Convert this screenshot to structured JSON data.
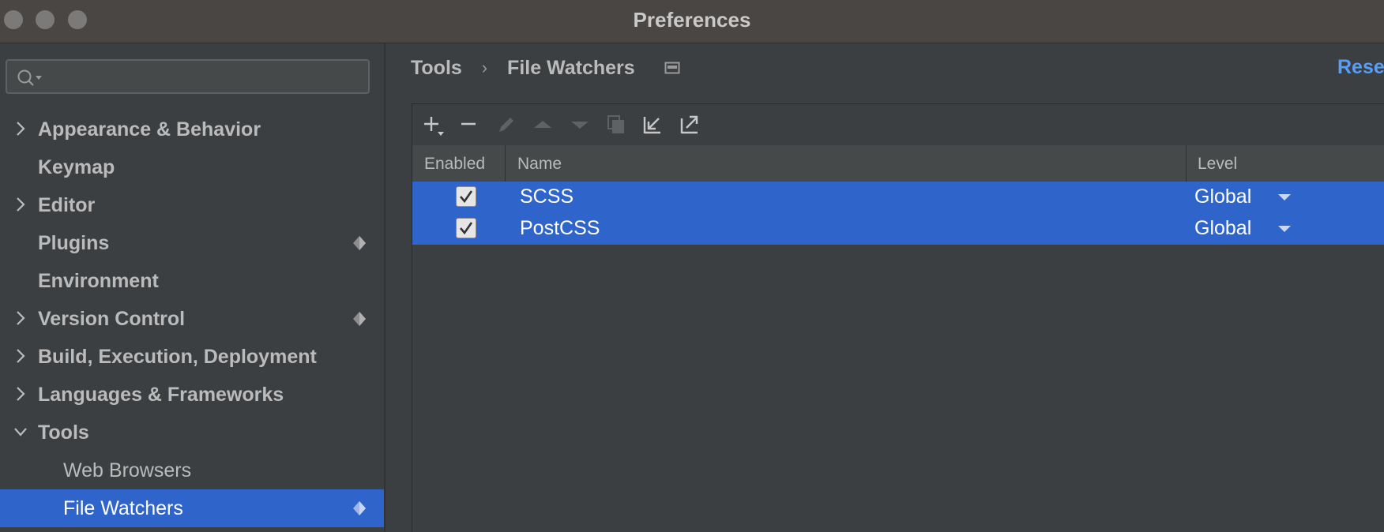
{
  "window": {
    "title": "Preferences"
  },
  "sidebar": {
    "search": {
      "placeholder": ""
    },
    "items": [
      {
        "label": "Appearance & Behavior",
        "expandable": true,
        "expanded": false,
        "badge": false
      },
      {
        "label": "Keymap",
        "expandable": false,
        "badge": false
      },
      {
        "label": "Editor",
        "expandable": true,
        "expanded": false,
        "badge": false
      },
      {
        "label": "Plugins",
        "expandable": false,
        "badge": true
      },
      {
        "label": "Environment",
        "expandable": false,
        "badge": false
      },
      {
        "label": "Version Control",
        "expandable": true,
        "expanded": false,
        "badge": true
      },
      {
        "label": "Build, Execution, Deployment",
        "expandable": true,
        "expanded": false,
        "badge": false
      },
      {
        "label": "Languages & Frameworks",
        "expandable": true,
        "expanded": false,
        "badge": false
      },
      {
        "label": "Tools",
        "expandable": true,
        "expanded": true,
        "badge": false
      },
      {
        "label": "Web Browsers",
        "sub": true,
        "badge": false
      },
      {
        "label": "File Watchers",
        "sub": true,
        "selected": true,
        "badge": true
      }
    ]
  },
  "main": {
    "breadcrumb": {
      "parent": "Tools",
      "separator": "›",
      "current": "File Watchers"
    },
    "reset_label": "Rese",
    "toolbar": [
      "add-icon",
      "remove-icon",
      "edit-icon",
      "move-up-icon",
      "move-down-icon",
      "copy-icon",
      "import-icon",
      "export-icon"
    ],
    "table": {
      "columns": {
        "enabled": "Enabled",
        "name": "Name",
        "level": "Level"
      },
      "rows": [
        {
          "enabled": true,
          "name": "SCSS",
          "level": "Global"
        },
        {
          "enabled": true,
          "name": "PostCSS",
          "level": "Global"
        }
      ]
    }
  },
  "colors": {
    "accent": "#2f65ca",
    "link": "#589df6",
    "background": "#3c3f41"
  }
}
